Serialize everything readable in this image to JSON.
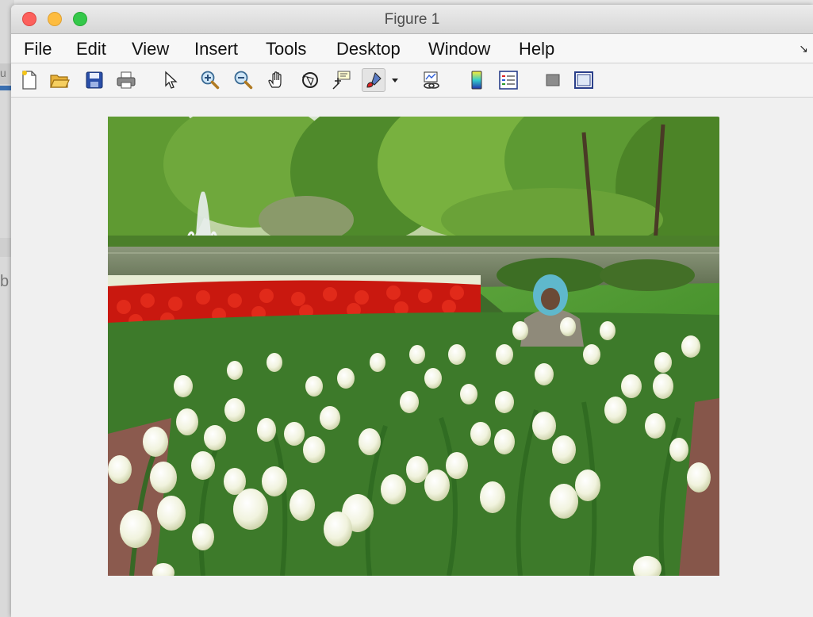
{
  "background_window": {
    "letters": [
      "u",
      "b"
    ]
  },
  "window": {
    "title": "Figure 1"
  },
  "menubar": {
    "items": [
      "File",
      "Edit",
      "View",
      "Insert",
      "Tools",
      "Desktop",
      "Window",
      "Help"
    ],
    "dock_glyph": "↘"
  },
  "toolbar": {
    "buttons": [
      {
        "icon": "new-figure-icon"
      },
      {
        "icon": "open-file-icon"
      },
      {
        "icon": "save-icon"
      },
      {
        "icon": "print-icon"
      },
      {
        "icon": "edit-plot-arrow-icon"
      },
      {
        "icon": "zoom-in-icon"
      },
      {
        "icon": "zoom-out-icon"
      },
      {
        "icon": "pan-hand-icon"
      },
      {
        "icon": "rotate-3d-icon"
      },
      {
        "icon": "data-cursor-icon"
      },
      {
        "icon": "brush-icon"
      },
      {
        "icon": "brush-dropdown-icon"
      },
      {
        "icon": "link-plot-icon"
      },
      {
        "icon": "colorbar-icon"
      },
      {
        "icon": "legend-icon"
      },
      {
        "icon": "hide-plot-tools-icon"
      },
      {
        "icon": "show-plot-tools-icon"
      }
    ]
  },
  "axes": {
    "image": "tulip-garden-photo"
  },
  "colors": {
    "title_text": "#4d4d4d",
    "close": "#fc605c",
    "minimize": "#fdbc40",
    "maximize": "#34c84a"
  }
}
